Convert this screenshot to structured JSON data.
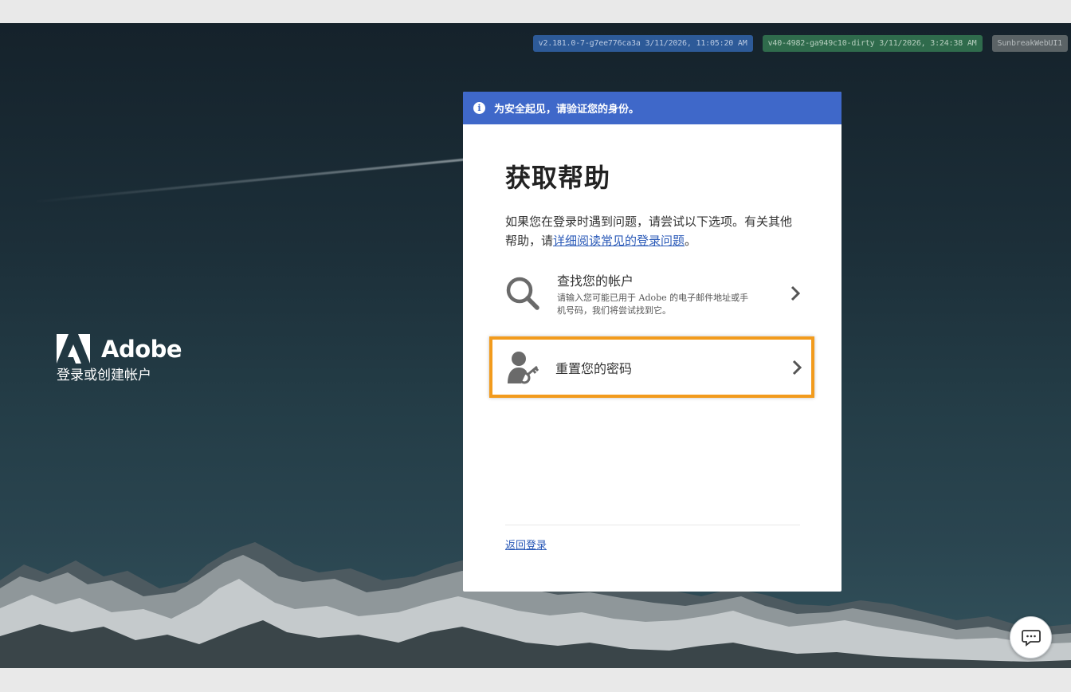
{
  "build_badges": [
    {
      "text": "v2.181.0-7-g7ee776ca3a 3/11/2026, 11:05:20 AM"
    },
    {
      "text": "v40-4982-ga949c10-dirty 3/11/2026, 3:24:38 AM"
    },
    {
      "text": "SunbreakWebUI1"
    }
  ],
  "brand": {
    "name": "Adobe",
    "tagline": "登录或创建帐户"
  },
  "card": {
    "notice": "为安全起见，请验证您的身份。",
    "title": "获取帮助",
    "intro_prefix": "如果您在登录时遇到问题，请尝试以下选项。有关其他帮助，请",
    "intro_link": "详细阅读常见的登录问题",
    "intro_suffix": "。",
    "options": [
      {
        "title": "查找您的帐户",
        "description": "请输入您可能已用于 Adobe 的电子邮件地址或手机号码，我们将尝试找到它。",
        "icon": "search-icon"
      },
      {
        "title": "重置您的密码",
        "icon": "user-key-icon",
        "highlighted": true
      }
    ],
    "back_link": "返回登录"
  },
  "colors": {
    "notice_bg": "#3f68c9",
    "highlight_border": "#f29b1d",
    "link": "#2c5bb8"
  },
  "chat": {
    "icon": "chat-icon"
  }
}
